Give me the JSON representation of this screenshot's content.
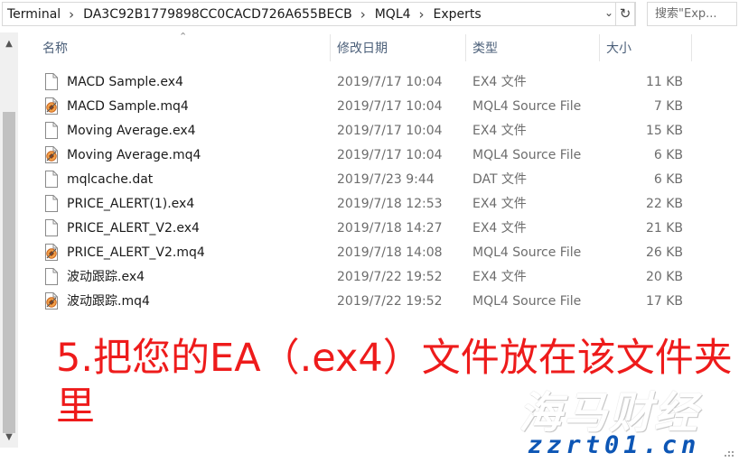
{
  "address_bar": {
    "crumbs": [
      "Terminal",
      "DA3C92B1779898CC0CACD726A655BECB",
      "MQL4",
      "Experts"
    ],
    "dropdown_icon": "chevron-down-icon",
    "refresh_icon": "refresh-icon",
    "search_placeholder": "搜索\"Exp..."
  },
  "columns": {
    "name": "名称",
    "date": "修改日期",
    "type": "类型",
    "size": "大小"
  },
  "files": [
    {
      "name": "MACD Sample.ex4",
      "date": "2019/7/17 10:04",
      "type": "EX4 文件",
      "size": "11 KB",
      "icon": "blank-file-icon"
    },
    {
      "name": "MACD Sample.mq4",
      "date": "2019/7/17 10:04",
      "type": "MQL4 Source File",
      "size": "7 KB",
      "icon": "mql4-source-icon"
    },
    {
      "name": "Moving Average.ex4",
      "date": "2019/7/17 10:04",
      "type": "EX4 文件",
      "size": "15 KB",
      "icon": "blank-file-icon"
    },
    {
      "name": "Moving Average.mq4",
      "date": "2019/7/17 10:04",
      "type": "MQL4 Source File",
      "size": "6 KB",
      "icon": "mql4-source-icon"
    },
    {
      "name": "mqlcache.dat",
      "date": "2019/7/23 9:44",
      "type": "DAT 文件",
      "size": "6 KB",
      "icon": "blank-file-icon"
    },
    {
      "name": "PRICE_ALERT(1).ex4",
      "date": "2019/7/18 12:53",
      "type": "EX4 文件",
      "size": "22 KB",
      "icon": "blank-file-icon"
    },
    {
      "name": "PRICE_ALERT_V2.ex4",
      "date": "2019/7/18 14:27",
      "type": "EX4 文件",
      "size": "21 KB",
      "icon": "blank-file-icon"
    },
    {
      "name": "PRICE_ALERT_V2.mq4",
      "date": "2019/7/18 14:08",
      "type": "MQL4 Source File",
      "size": "26 KB",
      "icon": "mql4-source-icon"
    },
    {
      "name": "波动跟踪.ex4",
      "date": "2019/7/22 19:52",
      "type": "EX4 文件",
      "size": "20 KB",
      "icon": "blank-file-icon"
    },
    {
      "name": "波动跟踪.mq4",
      "date": "2019/7/22 19:52",
      "type": "MQL4 Source File",
      "size": "17 KB",
      "icon": "mql4-source-icon"
    }
  ],
  "overlay": {
    "instruction": "5.把您的EA（.ex4）文件放在该文件夹里",
    "watermark_cn": "海马财经",
    "watermark_url": "zzrt01.cn"
  },
  "colors": {
    "instruction": "#ee1b1b",
    "watermark_url": "#0d56b5",
    "header_text": "#4c607a",
    "secondary_text": "#6d6d6d"
  }
}
